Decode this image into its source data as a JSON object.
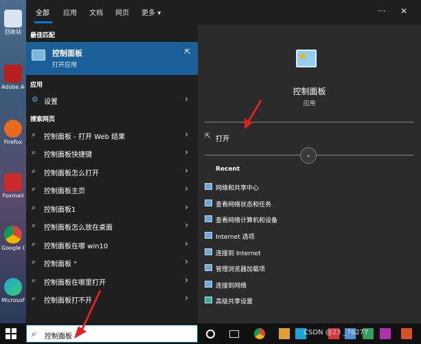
{
  "desktop": {
    "icons": [
      {
        "label": "回收站"
      },
      {
        "label": "Adobe Acroba"
      },
      {
        "label": "Firefox"
      },
      {
        "label": "Foxmail"
      },
      {
        "label": "Google Chrome"
      },
      {
        "label": "Microsoft Edge"
      }
    ]
  },
  "tabs": {
    "items": [
      "全部",
      "应用",
      "文档",
      "网页",
      "更多"
    ],
    "more_glyph": "▾",
    "menu_glyph": "···",
    "close_glyph": "✕"
  },
  "left": {
    "best_match_title": "最佳匹配",
    "best_match": {
      "name": "控制面板",
      "type": "打开应用",
      "open_glyph": "⇱"
    },
    "apps_title": "应用",
    "apps": [
      {
        "label": "设置",
        "icon": "gear-icon",
        "glyph": "⚙"
      }
    ],
    "web_title": "搜索网页",
    "web_results": [
      {
        "label": "控制面板 - 打开 Web 结果"
      },
      {
        "label": "控制面板快捷键"
      },
      {
        "label": "控制面板怎么打开"
      },
      {
        "label": "控制面板主页"
      },
      {
        "label": "控制面板1"
      },
      {
        "label": "控制面板怎么放在桌面"
      },
      {
        "label": "控制面板在哪 win10"
      },
      {
        "label": "控制面板 ”"
      },
      {
        "label": "控制面板在哪里打开"
      },
      {
        "label": "控制面板打不开"
      }
    ],
    "search_glyph": "⌕",
    "chevron_glyph": "›"
  },
  "right": {
    "title": "控制面板",
    "subtitle": "应用",
    "open_label": "打开",
    "open_glyph": "⇱",
    "expand_glyph": "⌄",
    "recent_title": "Recent",
    "recent": [
      "网络和共享中心",
      "查看网络状态和任务",
      "查看网络计算机和设备",
      "Internet 选项",
      "连接到 Internet",
      "管理浏览器加载项",
      "连接到网络",
      "高级共享设置"
    ]
  },
  "taskbar": {
    "search_value": "控制面板",
    "search_glyph": "⌕",
    "watermark": "CSDN @23 _76277"
  },
  "colors": {
    "accent": "#0078d4",
    "best_match_bg": "#1a5f99",
    "panel_bg": "#1f1f1f",
    "detail_bg": "#2b2b2b",
    "arrow": "#e02020"
  }
}
